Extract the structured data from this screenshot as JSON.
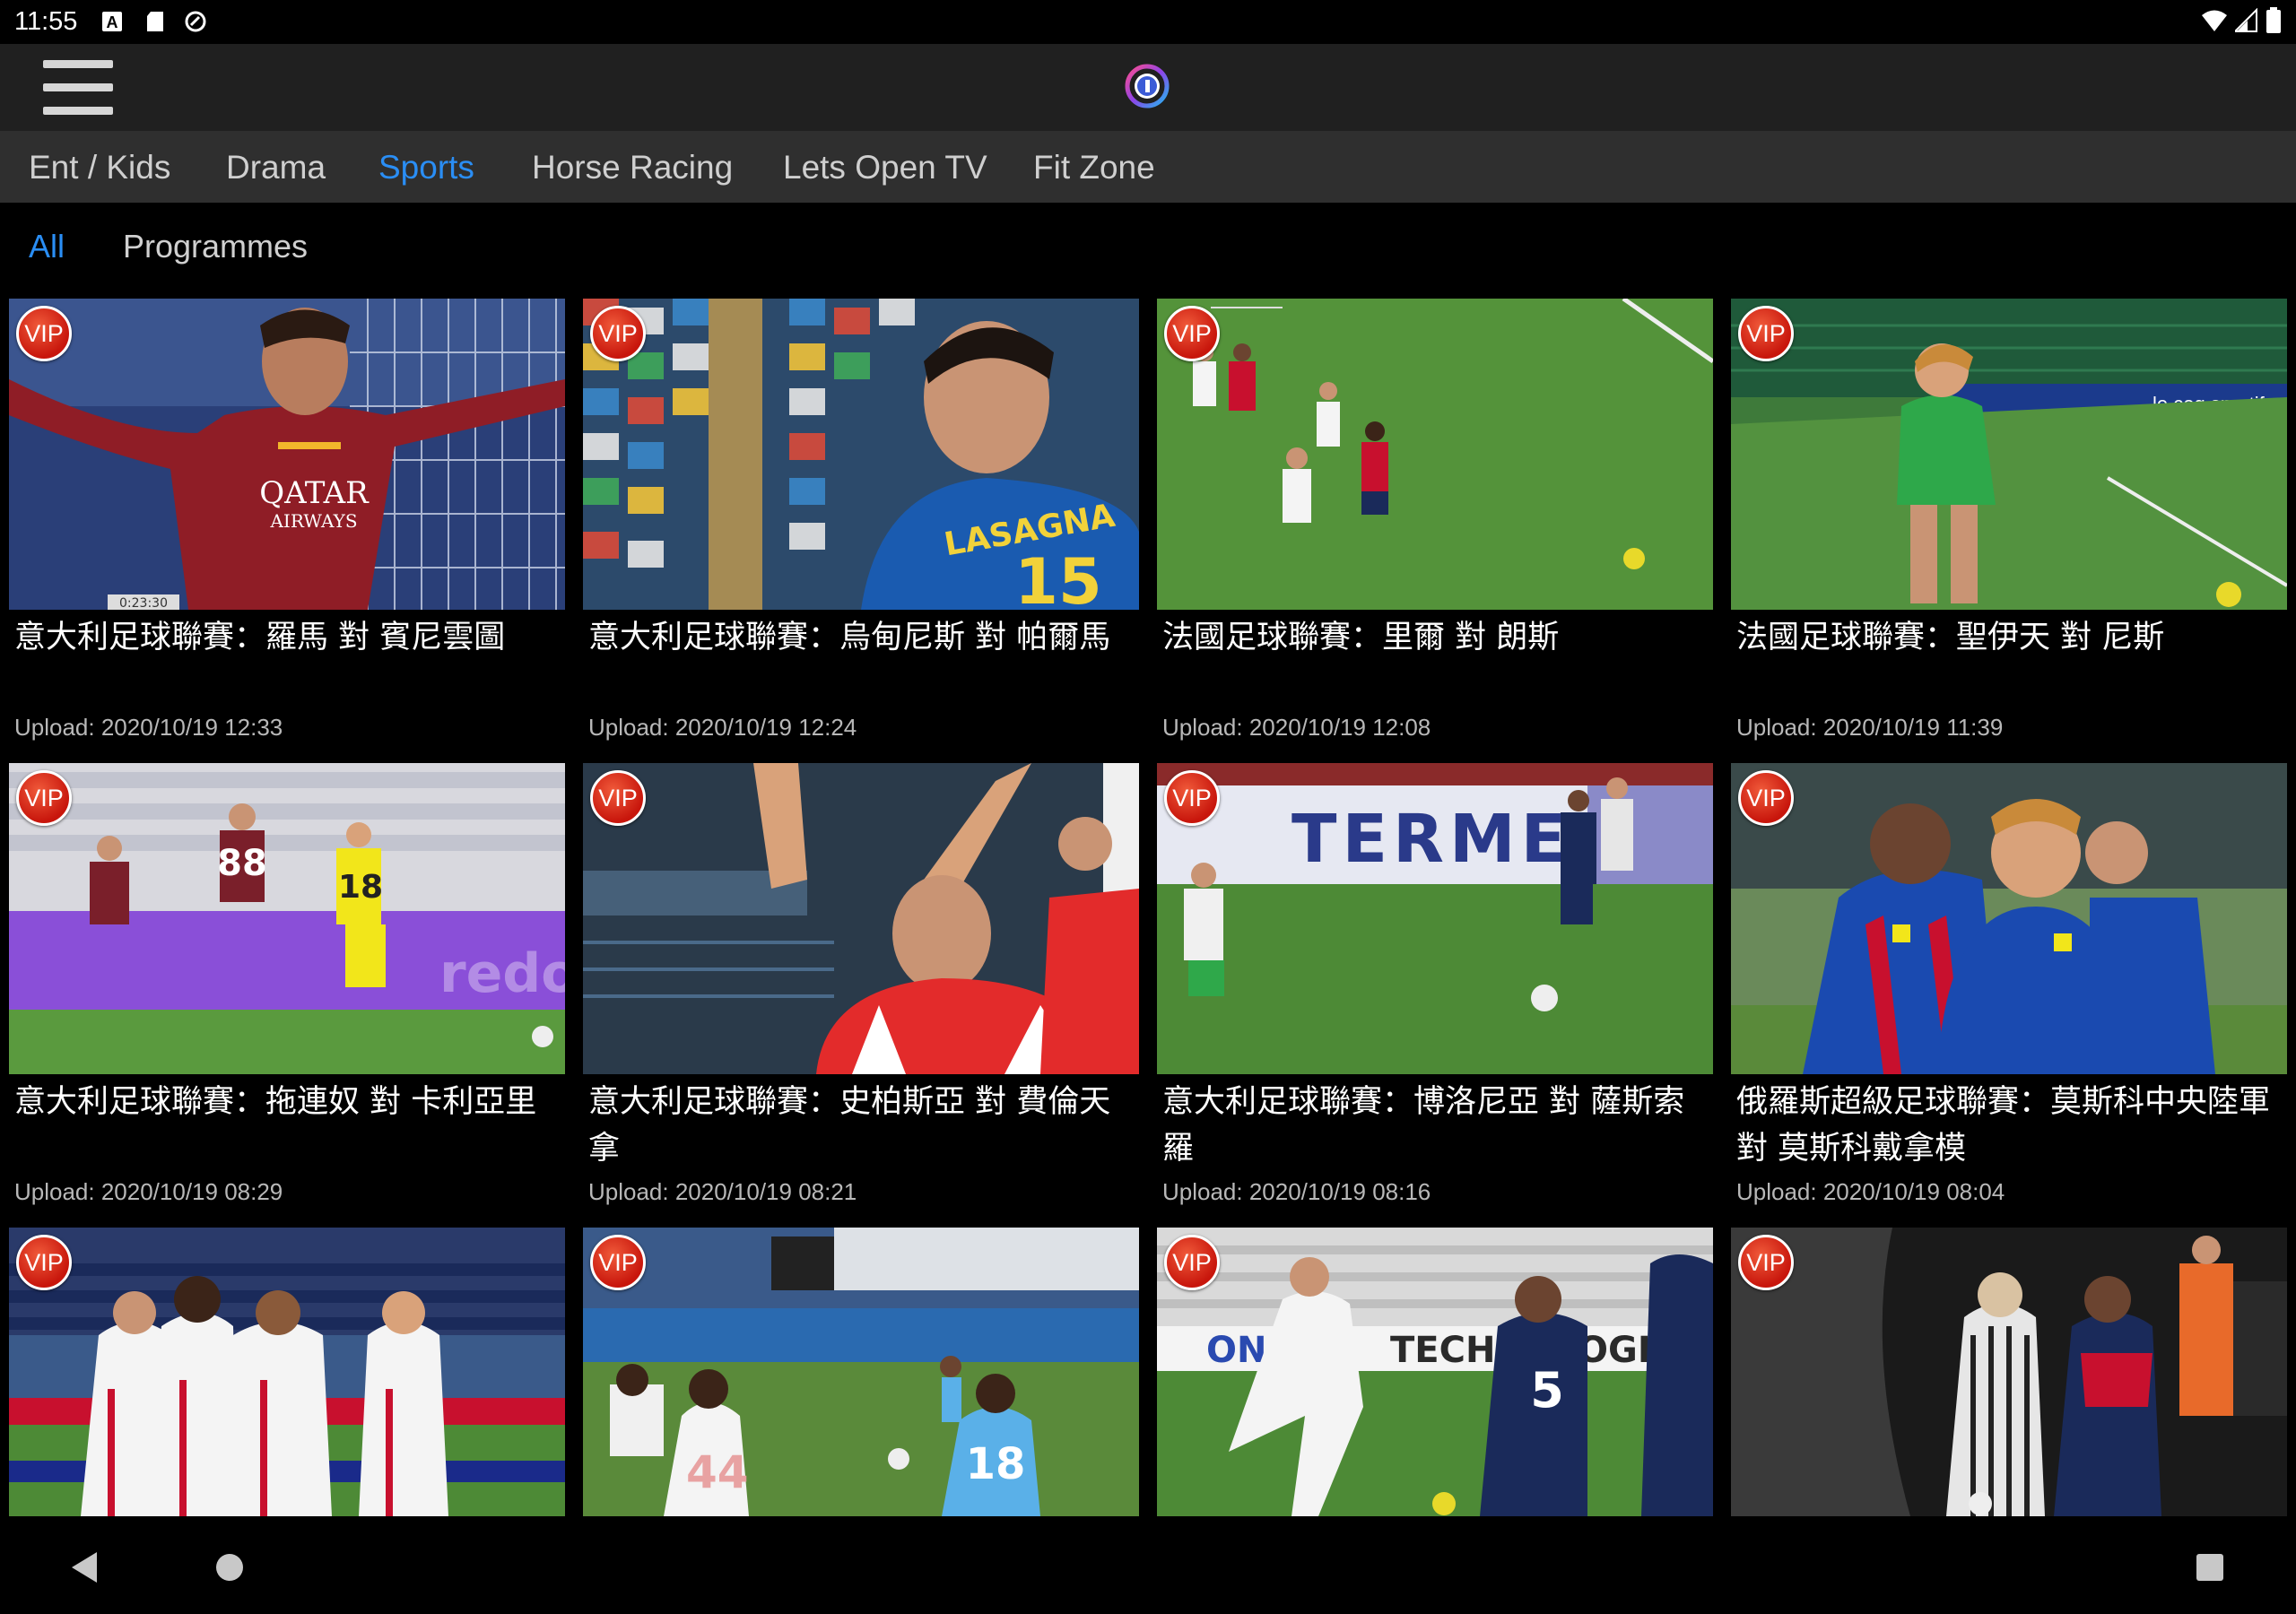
{
  "status_bar": {
    "time": "11:55",
    "icons": [
      "a-badge-icon",
      "sd-card-icon",
      "sync-icon"
    ],
    "right_icons": [
      "wifi-icon",
      "signal-icon",
      "battery-icon"
    ]
  },
  "app_bar": {
    "menu_icon": "hamburger-menu-icon",
    "logo": "app-logo-icon"
  },
  "category_tabs": [
    {
      "label": "Ent / Kids",
      "active": false
    },
    {
      "label": "Drama",
      "active": false
    },
    {
      "label": "Sports",
      "active": true
    },
    {
      "label": "Horse Racing",
      "active": false
    },
    {
      "label": "Lets Open TV",
      "active": false
    },
    {
      "label": "Fit Zone",
      "active": false
    }
  ],
  "sub_tabs": [
    {
      "label": "All",
      "active": true
    },
    {
      "label": "Programmes",
      "active": false
    }
  ],
  "videos": [
    {
      "vip": "VIP",
      "title": "意大利足球聯賽：羅馬 對 賓尼雲圖",
      "upload": "Upload: 2020/10/19 12:33",
      "timestamp": "0:23:30"
    },
    {
      "vip": "VIP",
      "title": "意大利足球聯賽：烏甸尼斯 對 帕爾馬",
      "upload": "Upload: 2020/10/19 12:24"
    },
    {
      "vip": "VIP",
      "title": "法國足球聯賽：里爾 對 朗斯",
      "upload": "Upload: 2020/10/19 12:08"
    },
    {
      "vip": "VIP",
      "title": "法國足球聯賽：聖伊天 對 尼斯",
      "upload": "Upload: 2020/10/19 11:39"
    },
    {
      "vip": "VIP",
      "title": "意大利足球聯賽：拖連奴 對 卡利亞里",
      "upload": "Upload: 2020/10/19 08:29"
    },
    {
      "vip": "VIP",
      "title": "意大利足球聯賽：史柏斯亞 對 費倫天拿",
      "upload": "Upload: 2020/10/19 08:21"
    },
    {
      "vip": "VIP",
      "title": "意大利足球聯賽：博洛尼亞 對 薩斯索羅",
      "upload": "Upload: 2020/10/19 08:16"
    },
    {
      "vip": "VIP",
      "title": "俄羅斯超級足球聯賽：莫斯科中央陸軍 對 莫斯科戴拿模",
      "upload": "Upload: 2020/10/19 08:04"
    },
    {
      "vip": "VIP",
      "title": "",
      "upload": ""
    },
    {
      "vip": "VIP",
      "title": "",
      "upload": ""
    },
    {
      "vip": "VIP",
      "title": "",
      "upload": ""
    },
    {
      "vip": "VIP",
      "title": "",
      "upload": ""
    }
  ],
  "colors": {
    "accent": "#2a8ef5",
    "appbar": "#202020",
    "tabs_bg": "#2f2f2f",
    "vip": "#d9261a"
  },
  "nav_bar": {
    "icons": [
      "back-icon",
      "home-icon",
      "recents-icon"
    ]
  }
}
